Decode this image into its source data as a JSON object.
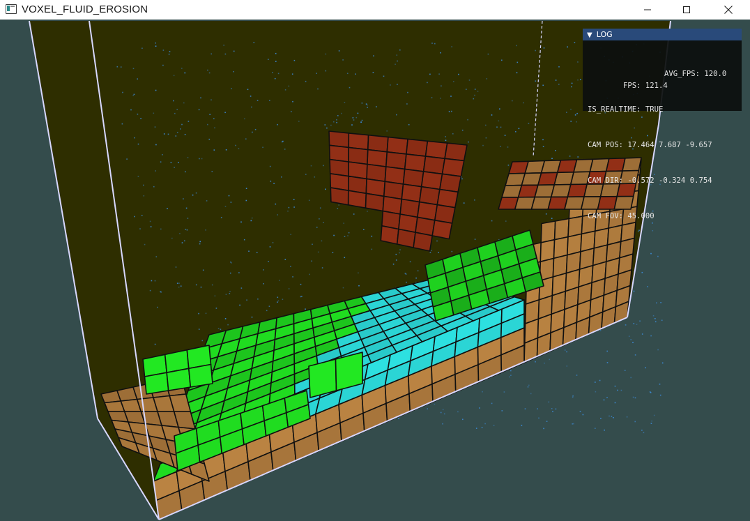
{
  "window": {
    "title": "VOXEL_FLUID_EROSION",
    "icon": "app-window-icon",
    "controls": {
      "minimize": "minimize-icon",
      "maximize": "maximize-icon",
      "close": "close-icon"
    }
  },
  "colors": {
    "background": "#344c4c",
    "container_back": "#2e2e00",
    "terrain_sand": "#c48a45",
    "terrain_rock": "#a23418",
    "fluid_green": "#22e822",
    "fluid_cyan": "#2de0e0",
    "bounds_lines": "#d8d8ff",
    "particles": "#3d8fe0"
  },
  "log": {
    "title": "LOG",
    "collapse_icon": "collapse-triangle-icon",
    "fps_label": "FPS: 121.4",
    "avg_fps_label": "AVG_FPS: 120.0",
    "is_realtime": "IS_REALTIME: TRUE",
    "cam_pos": "CAM POS: 17.464 7.687 -9.657",
    "cam_dir": "CAM DIR: -0.572 -0.324 0.754",
    "cam_fov": "CAM FOV: 45.000"
  }
}
